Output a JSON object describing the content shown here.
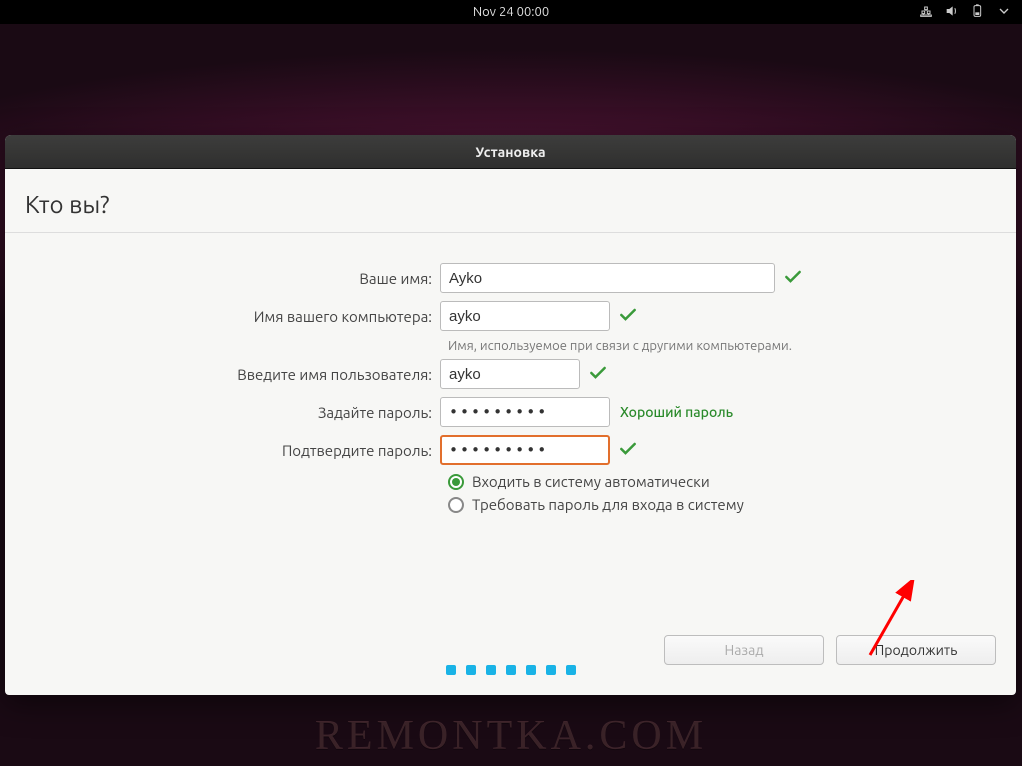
{
  "topbar": {
    "datetime": "Nov 24  00:00"
  },
  "installer": {
    "title": "Установка",
    "page_title": "Кто вы?",
    "fields": {
      "name": {
        "label": "Ваше имя:",
        "value": "Ayko"
      },
      "hostname": {
        "label": "Имя вашего компьютера:",
        "value": "ayko",
        "hint": "Имя, используемое при связи с другими компьютерами."
      },
      "username": {
        "label": "Введите имя пользователя:",
        "value": "ayko"
      },
      "password": {
        "label": "Задайте пароль:",
        "value": "•••••••••",
        "strength": "Хороший пароль"
      },
      "confirm": {
        "label": "Подтвердите пароль:",
        "value": "•••••••••"
      }
    },
    "login_options": {
      "auto": "Входить в систему автоматически",
      "require": "Требовать пароль для входа в систему",
      "selected": "auto"
    },
    "buttons": {
      "back": "Назад",
      "next": "Продолжить"
    },
    "pager_steps": 7
  },
  "watermark": "REMONTKA.COM"
}
